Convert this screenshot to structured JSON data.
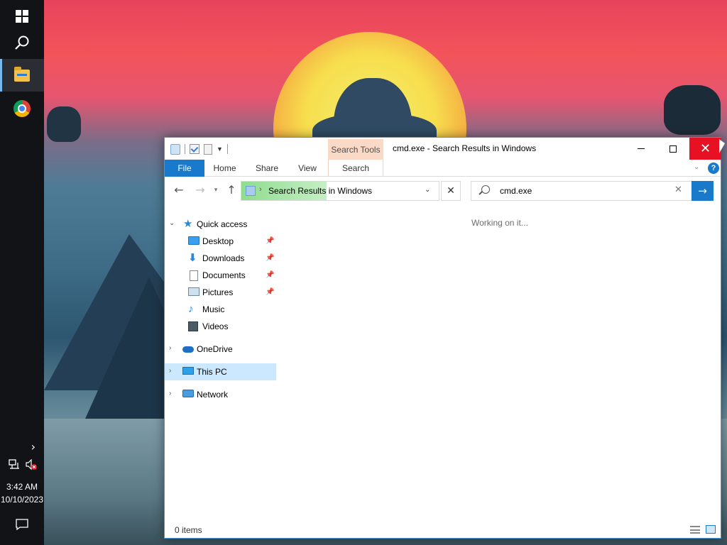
{
  "desktop": {
    "wallpaper": "King Kong silhouette against setting sun with helicopters"
  },
  "taskbar": {
    "items": [
      {
        "name": "start",
        "icon": "windows-logo-icon"
      },
      {
        "name": "search",
        "icon": "search-icon"
      },
      {
        "name": "file-explorer",
        "icon": "folder-icon",
        "active": true
      },
      {
        "name": "chrome",
        "icon": "chrome-icon"
      }
    ],
    "tray": {
      "expand_glyph": "›",
      "network_icon": "network-icon",
      "volume_icon": "volume-muted-icon",
      "time": "3:42 AM",
      "date": "10/10/2023",
      "notifications_icon": "action-center-icon"
    }
  },
  "window": {
    "title": "cmd.exe - Search Results in Windows",
    "contextual_tab_group": "Search Tools",
    "controls": {
      "minimize": "minimize-icon",
      "maximize": "maximize-icon",
      "close": "close-icon"
    },
    "ribbon_tabs": [
      {
        "label": "File",
        "active": true
      },
      {
        "label": "Home"
      },
      {
        "label": "Share"
      },
      {
        "label": "View"
      },
      {
        "label": "Search"
      }
    ],
    "help_glyph": "?",
    "address": {
      "separator": "›",
      "location": "Search Results in Windows"
    },
    "search": {
      "value": "cmd.exe",
      "placeholder": ""
    },
    "nav_glyphs": {
      "back": "←",
      "forward": "→",
      "recent": "⌄",
      "up": "↑",
      "stop": "✕",
      "clear": "✕",
      "go": "→"
    },
    "nav_pane": {
      "quick_access": "Quick access",
      "items": [
        {
          "label": "Desktop",
          "pinned": true
        },
        {
          "label": "Downloads",
          "pinned": true
        },
        {
          "label": "Documents",
          "pinned": true
        },
        {
          "label": "Pictures",
          "pinned": true
        },
        {
          "label": "Music",
          "pinned": false
        },
        {
          "label": "Videos",
          "pinned": false
        }
      ],
      "onedrive": "OneDrive",
      "this_pc": "This PC",
      "network": "Network"
    },
    "content": {
      "status_message": "Working on it..."
    },
    "status_bar": {
      "item_count": "0 items"
    }
  },
  "colors": {
    "accent": "#1979ca",
    "close_button": "#e81123",
    "contextual_tab": "#fad9c7",
    "selected_nav": "#cce8ff",
    "taskbar": "#111316"
  }
}
